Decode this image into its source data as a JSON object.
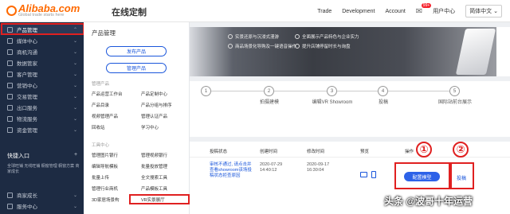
{
  "topbar": {
    "logo_text": "Alibaba.com",
    "logo_sub": "Global trade starts here",
    "title": "在线定制",
    "links": [
      "Trade",
      "Development",
      "Account"
    ],
    "msg_badge": "99+",
    "msg_label": "用户中心",
    "language": "简体中文 ⌄"
  },
  "sidebar": {
    "items": [
      {
        "label": "产品管理",
        "chev": "⌃"
      },
      {
        "label": "媒体中心",
        "chev": "⌄"
      },
      {
        "label": "商机沟通",
        "chev": "⌄"
      },
      {
        "label": "数据管家",
        "chev": "⌄"
      },
      {
        "label": "客户管理",
        "chev": "⌄"
      },
      {
        "label": "营销中心",
        "chev": "⌄"
      },
      {
        "label": "交易管理",
        "chev": "⌄"
      },
      {
        "label": "出口服务",
        "chev": "⌄"
      },
      {
        "label": "物流服务",
        "chev": "⌄"
      },
      {
        "label": "资金管理",
        "chev": "⌄"
      }
    ],
    "quick_title": "快捷入口",
    "quick_plus": "+",
    "quick_links": "全球旺铺  无线旺铺  橱窗管理  橱窗方案  商家成长",
    "bottom_items": [
      {
        "label": "商家成长",
        "chev": "⌄"
      },
      {
        "label": "服务中心",
        "chev": "⌄"
      }
    ]
  },
  "flyout": {
    "header": "产品管理",
    "btn_publish": "发布产品",
    "btn_manage": "管理产品",
    "sec_manage": "管理产品",
    "col1": [
      "产品运营工作台",
      "产品目录",
      "视频管理产品",
      "回收站"
    ],
    "col2": [
      "产品定制中心",
      "产品分组与排序",
      "管理认证产品",
      "学习中心"
    ],
    "sec_tools": "工具中心",
    "tools_col1": [
      "管理图片银行",
      "编辑导航模板",
      "批量上传",
      "管理行业商机",
      "3D家居场景构"
    ],
    "tools_col2": [
      "管理视频银行",
      "批量投放管理",
      "全文搜索工具",
      "产品模板工具",
      "VR实景展厅"
    ]
  },
  "banner": {
    "row1a": "实景还原与沉浸式漫游",
    "row1b": "全面展示产品特色与企业实力",
    "row2a": "商品场景化导购及一键语音操作",
    "row2b": "提升店铺停留时长与询盘"
  },
  "steps": [
    {
      "num": "1",
      "label": ""
    },
    {
      "num": "2",
      "label": "拍摄建模"
    },
    {
      "num": "3",
      "label": "编辑VR Showroom"
    },
    {
      "num": "4",
      "label": "投稿"
    },
    {
      "num": "5",
      "label": "国际站前台展示"
    }
  ],
  "table": {
    "headers": [
      "投稿状态",
      "创建时间",
      "修改时间",
      "预览",
      "操作"
    ],
    "status_text": "审核不通过, 请点击并查看showroom该场投稿状态拒查原因",
    "created": "2020-07-29 14:40:12",
    "modified": "2020-09-17 16:30:04",
    "config_btn": "配置模型",
    "post_btn": "投稿",
    "mark1": "①",
    "mark2": "②"
  },
  "watermark": "头条 @波哥十年运营"
}
